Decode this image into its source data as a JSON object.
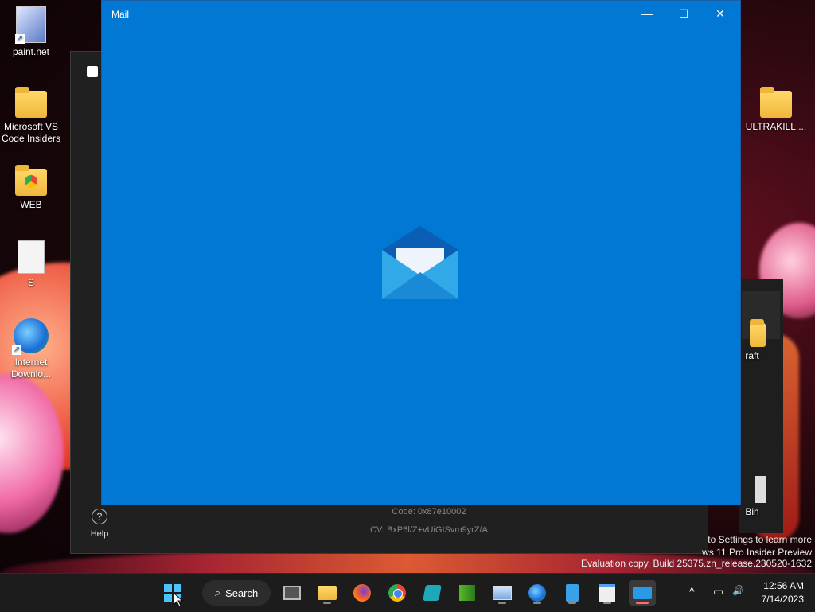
{
  "desktop": {
    "icons": [
      {
        "label": "paint.net"
      },
      {
        "label": "Microsoft VS Code Insiders"
      },
      {
        "label": "WEB"
      },
      {
        "label": "S"
      },
      {
        "label": "Internet Downlo..."
      },
      {
        "label": "ULTRAKILL...."
      },
      {
        "label": "raft"
      },
      {
        "label": "Bin"
      }
    ]
  },
  "background_window": {
    "code_line": "Code: 0x87e10002",
    "cv_line": "CV: BxP6l/Z+vUiGISvm9yrZ/A",
    "help_label": "Help",
    "help_icon": "?"
  },
  "watermark": {
    "line1": "to Settings to learn more",
    "line2": "ws 11 Pro Insider Preview",
    "line3": "Evaluation copy. Build 25375.zn_release.230520-1632"
  },
  "mail_window": {
    "title": "Mail",
    "minimize_icon": "—",
    "maximize_icon": "☐",
    "close_icon": "✕",
    "bg_color": "#0078d4"
  },
  "taskbar": {
    "search_label": "Search",
    "search_icon": "⌕",
    "tray_chevron": "^",
    "tray_network": "▭",
    "tray_volume": "🔊",
    "time": "12:56 AM",
    "date": "7/14/2023"
  }
}
